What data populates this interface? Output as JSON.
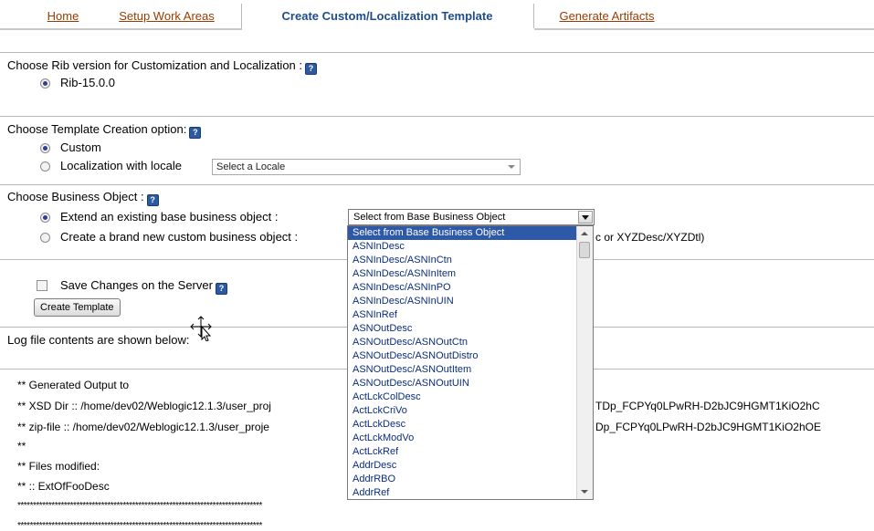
{
  "tabs": [
    {
      "label": "Home"
    },
    {
      "label": "Setup Work Areas"
    },
    {
      "label": "Create Custom/Localization Template"
    },
    {
      "label": "Generate Artifacts"
    }
  ],
  "rib_section": {
    "title": "Choose Rib version for Customization and Localization :",
    "option": "Rib-15.0.0"
  },
  "template_section": {
    "title": "Choose Template Creation option:",
    "opt_custom": "Custom",
    "opt_locale": "Localization with locale",
    "locale_select": "Select a Locale"
  },
  "bo_section": {
    "title": "Choose Business Object :",
    "opt_extend": "Extend an existing base business object :",
    "opt_create": "Create a brand new custom business object :",
    "create_hint": "c or XYZDesc/XYZDtl)",
    "combo_value": "Select from Base Business Object",
    "list_items": [
      "Select from Base Business Object",
      "ASNInDesc",
      "ASNInDesc/ASNInCtn",
      "ASNInDesc/ASNInItem",
      "ASNInDesc/ASNInPO",
      "ASNInDesc/ASNInUIN",
      "ASNInRef",
      "ASNOutDesc",
      "ASNOutDesc/ASNOutCtn",
      "ASNOutDesc/ASNOutDistro",
      "ASNOutDesc/ASNOutItem",
      "ASNOutDesc/ASNOutUIN",
      "ActLckColDesc",
      "ActLckCriVo",
      "ActLckDesc",
      "ActLckModVo",
      "ActLckRef",
      "AddrDesc",
      "AddrRBO",
      "AddrRef"
    ]
  },
  "save_section": {
    "checkbox_label": "Save Changes on the Server",
    "button": "Create Template"
  },
  "log": {
    "header": "Log file contents are shown below:",
    "line1": "** Generated Output to",
    "line2": "** XSD Dir :: /home/dev02/Weblogic12.1.3/user_proj",
    "line2_tail": "TDp_FCPYq0LPwRH-D2bJC9HGMT1KiO2hC",
    "line3": "** zip-file :: /home/dev02/Weblogic12.1.3/user_proje",
    "line3_tail": "Dp_FCPYq0LPwRH-D2bJC9HGMT1KiO2hOE",
    "line4": "**",
    "line5": "** Files modified:",
    "line6": "** :: ExtOfFooDesc",
    "stars1": "*******************************************************************************",
    "stars2": "*******************************************************************************"
  }
}
